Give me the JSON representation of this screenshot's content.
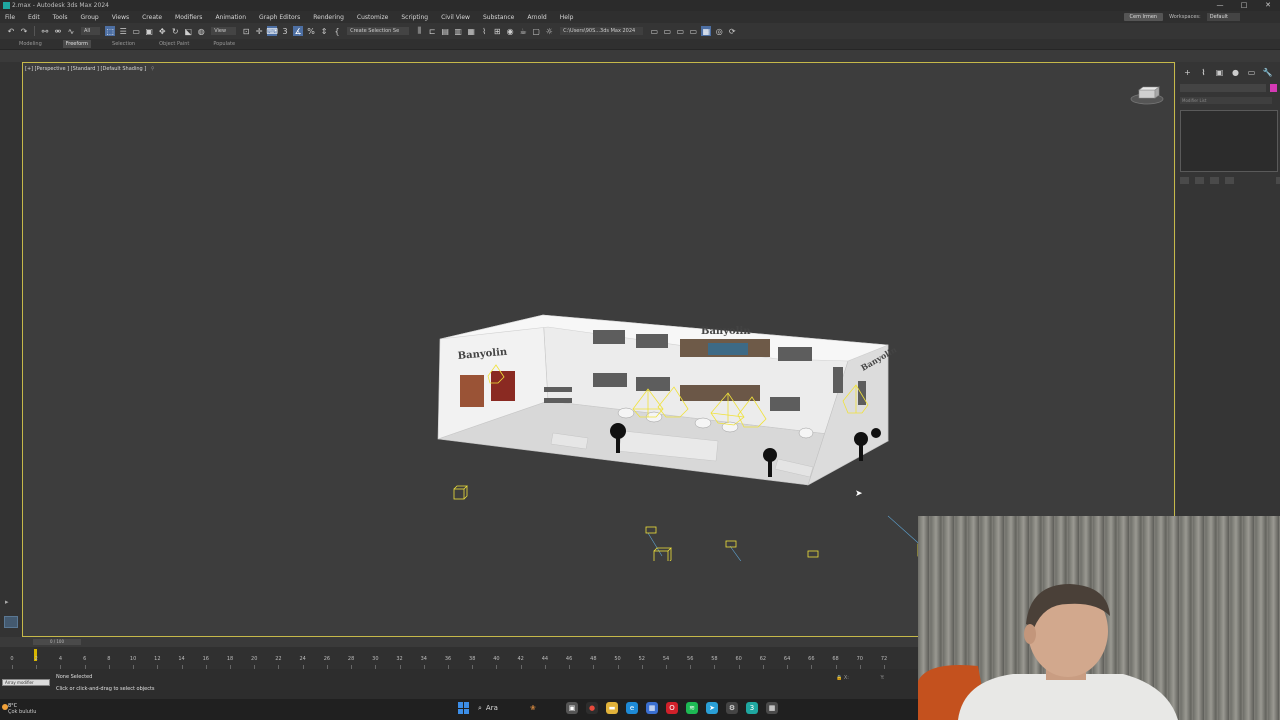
{
  "window": {
    "title": "2.max - Autodesk 3ds Max 2024",
    "controls": [
      "—",
      "□",
      "✕"
    ]
  },
  "menubar": {
    "items": [
      "File",
      "Edit",
      "Tools",
      "Group",
      "Views",
      "Create",
      "Modifiers",
      "Animation",
      "Graph Editors",
      "Rendering",
      "Customize",
      "Scripting",
      "Civil View",
      "Substance",
      "Arnold",
      "Help"
    ],
    "user": "Cem Irmen",
    "workspaces_label": "Workspaces:",
    "workspace_value": "Default"
  },
  "toolbar": {
    "selection_filter": "All",
    "view_dropdown": "View",
    "create_selection_set": "Create Selection Se",
    "project_path": "C:\\Users\\90S...3ds Max 2024"
  },
  "ribbon": {
    "tabs": [
      "Modeling",
      "Freeform",
      "Selection",
      "Object Paint",
      "Populate"
    ],
    "active": "Freeform"
  },
  "viewport": {
    "label": "[+] [Perspective ] [Standard ] [Default Shading ]",
    "filter_icon": "funnel-icon",
    "border_color": "#c6b94a",
    "model": {
      "brand_text": "Banyolin",
      "wall_color": "#e2e2e2",
      "helper_color": "#f0e23a"
    }
  },
  "command_panel": {
    "tabs": [
      "+",
      "⌇",
      "▣",
      "●",
      "▭",
      "🔧"
    ],
    "active_tab": 1,
    "modifier_list": "Modifier List",
    "object_color": "#d53ab5"
  },
  "timeline": {
    "range": "0 / 100",
    "current_frame": 0,
    "ticks": [
      0,
      2,
      4,
      6,
      8,
      10,
      12,
      14,
      16,
      18,
      20,
      22,
      24,
      26,
      28,
      30,
      32,
      34,
      36,
      38,
      40,
      42,
      44,
      46,
      48,
      50,
      52,
      54,
      56,
      58,
      60,
      62,
      64,
      66,
      68,
      70,
      72
    ]
  },
  "statusbar": {
    "maxscript_text": "Array modifier",
    "selection_status": "None Selected",
    "prompt": "Click or click-and-drag to select objects",
    "coord_x_label": "X:",
    "coord_y_label": "Y:"
  },
  "taskbar": {
    "weather_temp": "8°C",
    "weather_desc": "Çok bulutlu",
    "search_label": "Ara",
    "apps": [
      "file-explorer-icon",
      "chrome-icon",
      "folder-icon",
      "edge-icon",
      "store-icon",
      "opera-icon",
      "spotify-icon",
      "telegram-icon",
      "steam-icon",
      "3dsmax-icon",
      "photoshop-icon"
    ]
  }
}
